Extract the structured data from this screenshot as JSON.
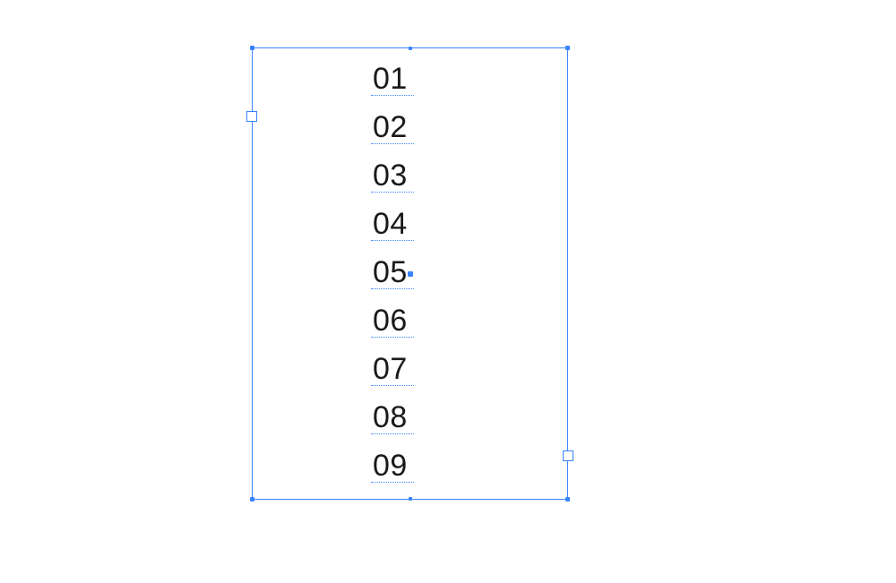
{
  "colors": {
    "selection": "#3a84ff",
    "text": "#1a1a1a"
  },
  "text_frame": {
    "lines": [
      "01",
      "02",
      "03",
      "04",
      "05",
      "06",
      "07",
      "08",
      "09"
    ]
  }
}
